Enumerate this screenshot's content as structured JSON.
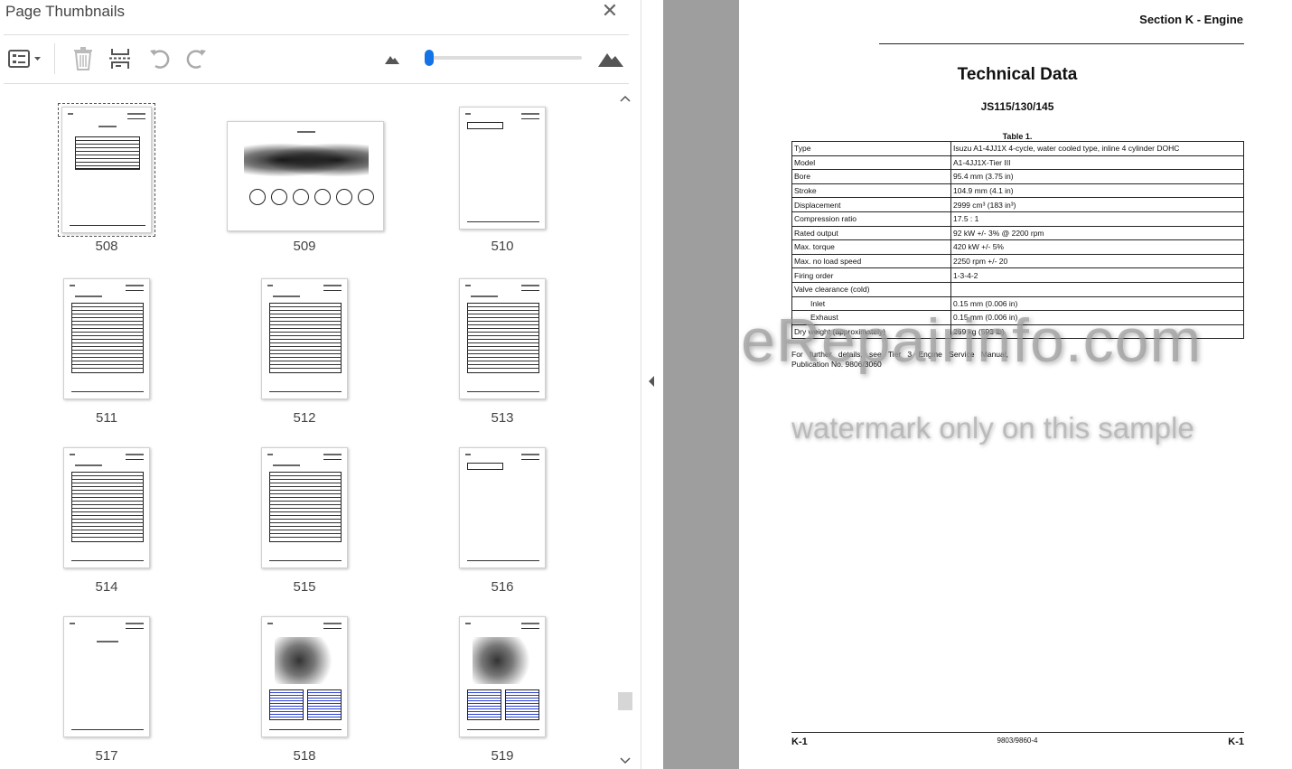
{
  "panel": {
    "title": "Page Thumbnails",
    "close_glyph": "✕"
  },
  "toolbar": {
    "options_icon": "list-options-icon",
    "delete_icon": "trash-icon",
    "insert_icon": "insert-pages-icon",
    "undo_icon": "rotate-left-icon",
    "redo_icon": "rotate-right-icon",
    "zoom_out_icon": "small-mountain-icon",
    "zoom_in_icon": "large-mountain-icon",
    "zoom_level": 0.0
  },
  "thumbnails": [
    {
      "label": "508",
      "kind": "table-page",
      "selected": true
    },
    {
      "label": "509",
      "kind": "engine-landscape",
      "selected": false
    },
    {
      "label": "510",
      "kind": "small-table",
      "selected": false
    },
    {
      "label": "511",
      "kind": "big-table",
      "selected": false
    },
    {
      "label": "512",
      "kind": "big-table",
      "selected": false
    },
    {
      "label": "513",
      "kind": "big-table",
      "selected": false
    },
    {
      "label": "514",
      "kind": "big-table",
      "selected": false
    },
    {
      "label": "515",
      "kind": "big-table",
      "selected": false
    },
    {
      "label": "516",
      "kind": "small-table",
      "selected": false
    },
    {
      "label": "517",
      "kind": "blank",
      "selected": false
    },
    {
      "label": "518",
      "kind": "engine-figure",
      "selected": false
    },
    {
      "label": "519",
      "kind": "engine-figure",
      "selected": false
    }
  ],
  "document": {
    "section": "Section K - Engine",
    "title": "Technical Data",
    "model": "JS115/130/145",
    "table_caption": "Table 1.",
    "rows": [
      {
        "label": "Type",
        "value": "Isuzu A1-4JJ1X 4-cycle, water cooled type, inline 4 cylinder DOHC",
        "indent": false
      },
      {
        "label": "Model",
        "value": "A1-4JJ1X-Tier III",
        "indent": false
      },
      {
        "label": "Bore",
        "value": "95.4 mm (3.75 in)",
        "indent": false
      },
      {
        "label": "Stroke",
        "value": "104.9 mm (4.1 in)",
        "indent": false
      },
      {
        "label": "Displacement",
        "value": "2999 cm³ (183 in³)",
        "indent": false
      },
      {
        "label": "Compression ratio",
        "value": "17.5 : 1",
        "indent": false
      },
      {
        "label": "Rated output",
        "value": "92 kW +/- 3% @ 2200 rpm",
        "indent": false
      },
      {
        "label": "Max. torque",
        "value": "420 kW +/- 5%",
        "indent": false
      },
      {
        "label": "Max. no load speed",
        "value": "2250 rpm +/- 20",
        "indent": false
      },
      {
        "label": "Firing order",
        "value": "1-3-4-2",
        "indent": false
      },
      {
        "label": "Valve clearance (cold)",
        "value": "",
        "indent": false
      },
      {
        "label": "Inlet",
        "value": "0.15 mm (0.006 in)",
        "indent": true
      },
      {
        "label": "Exhaust",
        "value": "0.15 mm (0.006 in)",
        "indent": true
      },
      {
        "label": "Dry weight (approximately)",
        "value": "269 kg (593 lb)",
        "indent": false
      }
    ],
    "note": "For further details, see Tier 3 Engine Service Manual, Publication No. 9806/3060",
    "footer_left": "K-1",
    "footer_center": "9803/9860-4",
    "footer_right": "K-1"
  },
  "watermark": {
    "line1": "eRepairinfo.com",
    "line2": "watermark only on this sample"
  },
  "scroll": {
    "up": "⌃",
    "down": "⌄"
  },
  "splitter": {
    "arrow": "◀"
  }
}
